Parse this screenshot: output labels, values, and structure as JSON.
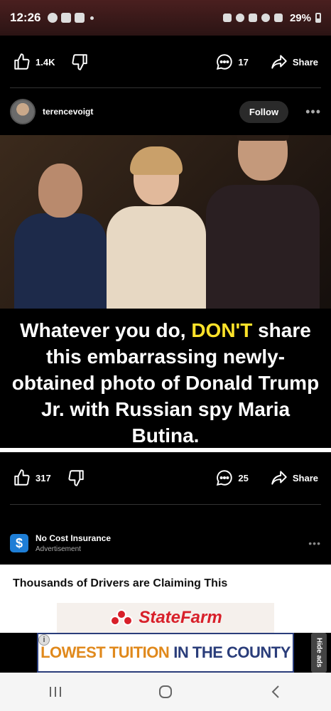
{
  "status_bar": {
    "time": "12:26",
    "battery": "29%"
  },
  "post1_actions": {
    "likes": "1.4K",
    "comments": "17",
    "share": "Share"
  },
  "post2": {
    "username": "terencevoigt",
    "follow": "Follow",
    "caption_before": "Whatever you do, ",
    "caption_highlight": "DON'T",
    "caption_after": " share this embarrassing newly-obtained photo of Donald Trump Jr. with Russian spy Maria Butina.",
    "likes": "317",
    "comments": "25",
    "share": "Share"
  },
  "ad": {
    "title": "No Cost Insurance",
    "subtitle": "Advertisement",
    "headline": "Thousands of Drivers are Claiming This",
    "brand": "StateFarm"
  },
  "banner": {
    "highlight": "LOWEST TUITION",
    "rest": "IN THE COUNTY",
    "hide": "Hide ads"
  },
  "colors": {
    "caption_highlight": "#ffe32a",
    "statefarm_red": "#d8202a",
    "banner_blue": "#2a3d7a",
    "banner_orange": "#e0891c"
  }
}
